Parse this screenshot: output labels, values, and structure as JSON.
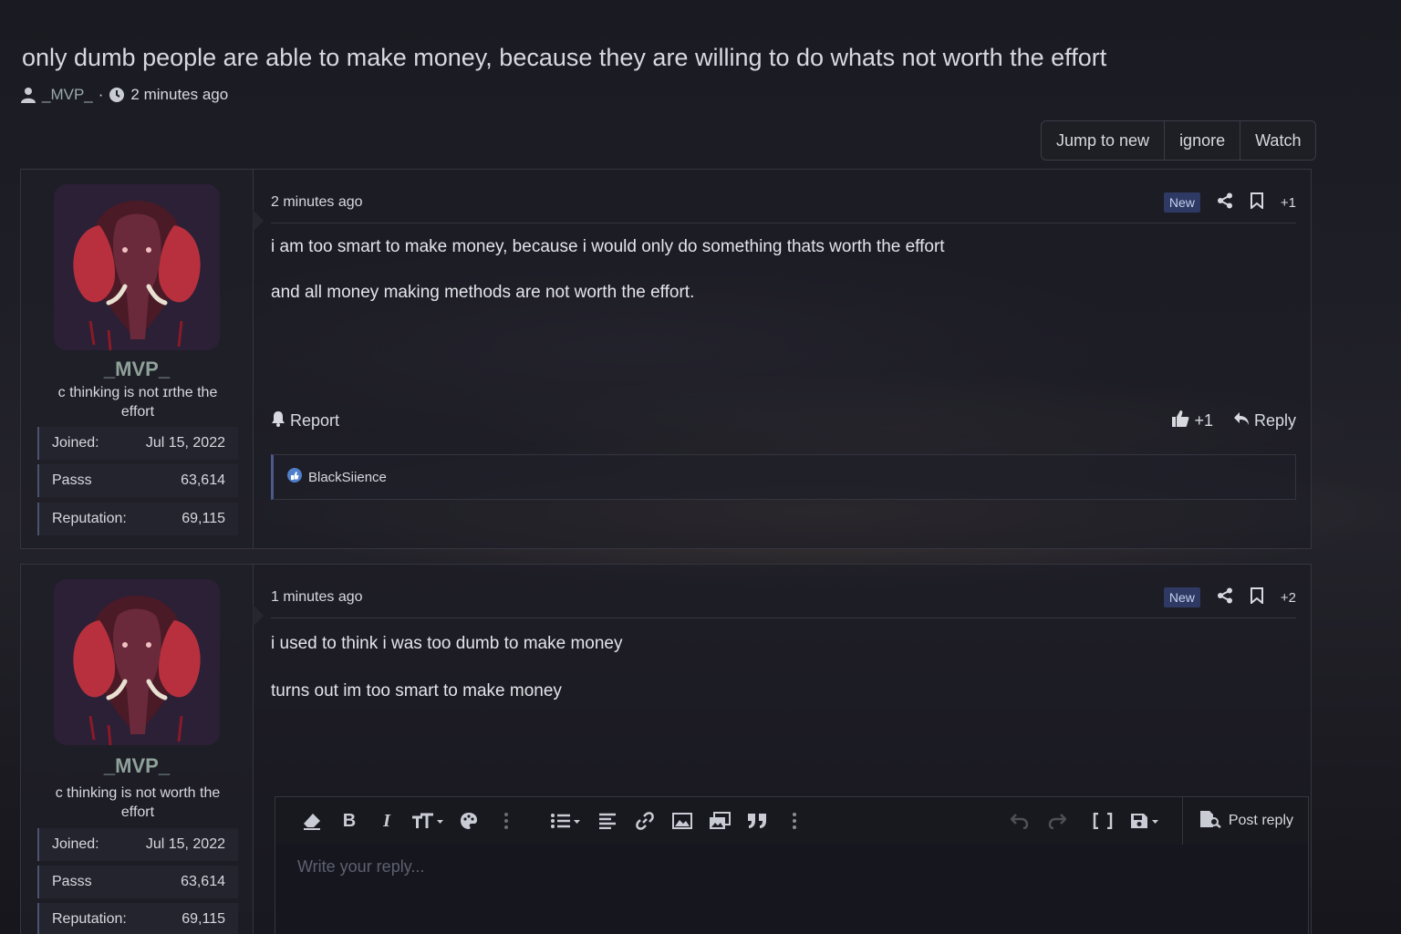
{
  "thread": {
    "title": "only dumb people are able to make money, because they are willing to do whats not worth the effort",
    "author": "_MVP_",
    "separator": "·",
    "time": "2 minutes ago"
  },
  "actions": {
    "jump_to_new": "Jump to new",
    "ignore": "ignore",
    "watch": "Watch"
  },
  "posts": [
    {
      "date": "2 minutes ago",
      "badge": "New",
      "number": "+1",
      "body": [
        "i am too smart to make money, because i would only do something thats worth the effort",
        "and all money making methods are not worth the effort."
      ],
      "user": {
        "name": "_MVP_",
        "title": "c thinking is not ɪrthe the effort",
        "stats": [
          {
            "label": "Joined:",
            "value": "Jul 15, 2022"
          },
          {
            "label": "Passs",
            "value": "63,614"
          },
          {
            "label": "Reputation:",
            "value": "69,115"
          }
        ]
      },
      "report": "Report",
      "like_count": "+1",
      "reply": "Reply",
      "reaction_user": "BlackSiience"
    },
    {
      "date": "1 minutes ago",
      "badge": "New",
      "number": "+2",
      "body": [
        "i used to think i was too dumb to make money",
        "turns out im too smart to make money"
      ],
      "user": {
        "name": "_MVP_",
        "title": "c thinking is not worth the effort",
        "stats": [
          {
            "label": "Joined:",
            "value": "Jul 15, 2022"
          },
          {
            "label": "Passs",
            "value": "63,614"
          },
          {
            "label": "Reputation:",
            "value": "69,115"
          }
        ]
      }
    }
  ],
  "editor": {
    "placeholder": "Write your reply...",
    "post_reply": "Post reply"
  },
  "colors": {
    "accent": "#4a5a8a",
    "username": "#8fa29a",
    "badge_bg": "#2e3a63"
  }
}
